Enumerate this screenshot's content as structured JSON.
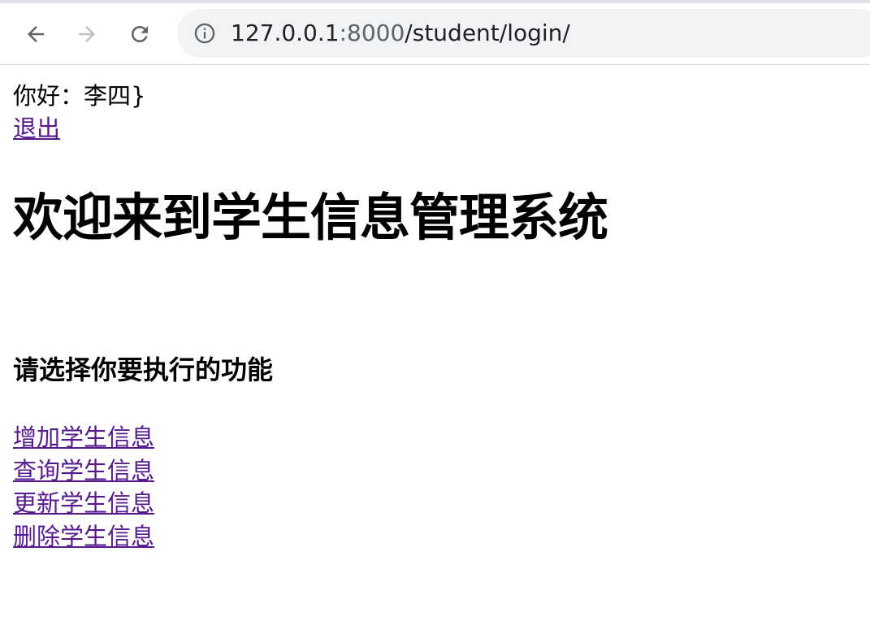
{
  "browser": {
    "url_host": "127.0.0.1",
    "url_port": ":8000",
    "url_path": "/student/login/"
  },
  "page": {
    "greeting": "你好：李四}",
    "logout": "退出",
    "title": "欢迎来到学生信息管理系统",
    "subtitle": "请选择你要执行的功能",
    "functions": [
      {
        "label": "增加学生信息"
      },
      {
        "label": "查询学生信息"
      },
      {
        "label": "更新学生信息"
      },
      {
        "label": "删除学生信息"
      }
    ]
  },
  "colors": {
    "link": "#551a8b",
    "omnibox_bg": "#f1f3f4",
    "icon": "#5f6368"
  }
}
